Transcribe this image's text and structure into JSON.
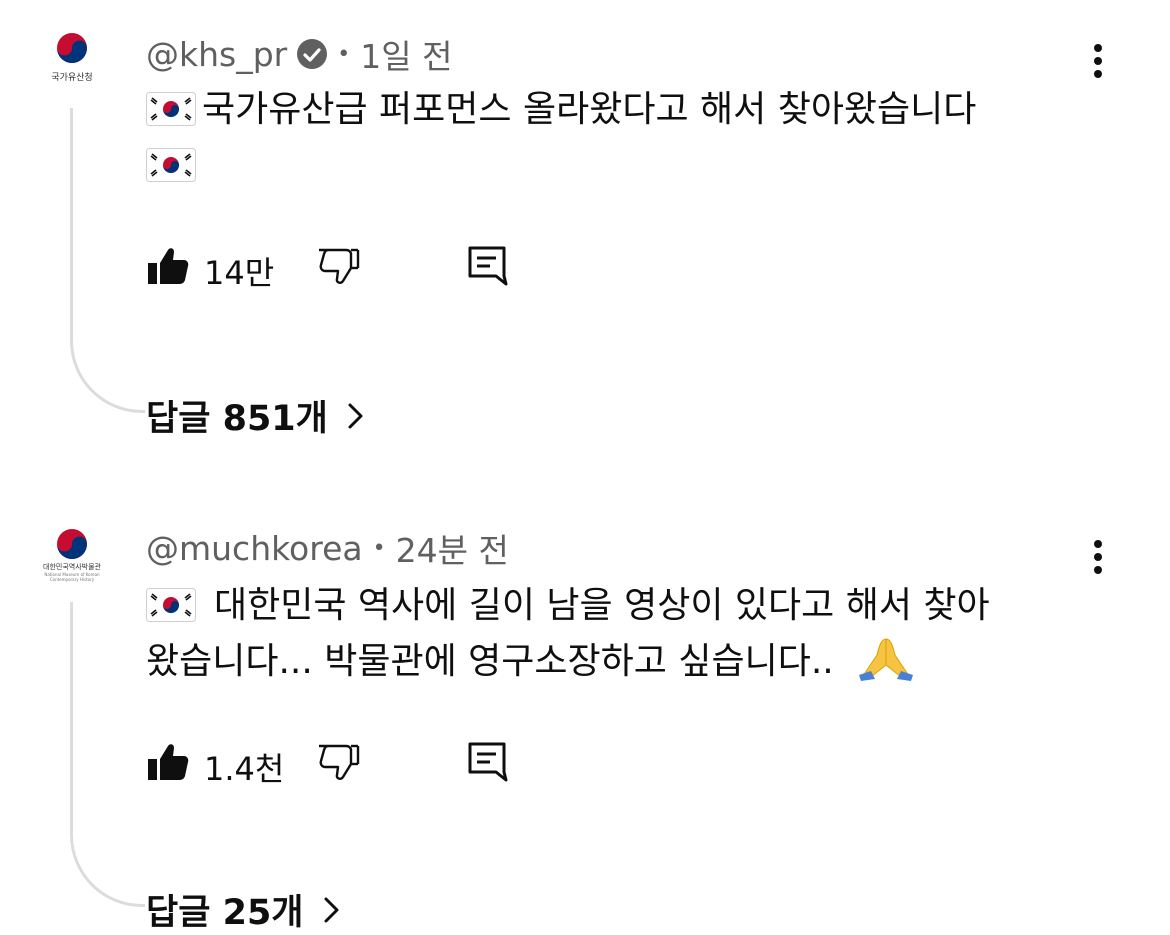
{
  "comments": [
    {
      "avatar_label": "국가유산청",
      "avatar_sub": "",
      "handle": "@khs_pr",
      "verified": true,
      "time": "1일 전",
      "text_line1": "국가유산급 퍼포먼스 올라왔다고 해서 찾아왔습니다",
      "text_line2": "",
      "likes": "14만",
      "replies": "답글 851개"
    },
    {
      "avatar_label": "대한민국역사박물관",
      "avatar_sub": "National Museum of Korean Contemporary History",
      "handle": "@muchkorea",
      "verified": false,
      "time": "24분 전",
      "text_line1": "대한민국 역사에 길이 남을 영상이 있다고 해서 찾아",
      "text_line2": "왔습니다... 박물관에 영구소장하고 싶습니다..",
      "likes": "1.4천",
      "replies": "답글 25개"
    }
  ],
  "icons": {
    "like": "thumbs-up-filled-icon",
    "dislike": "thumbs-down-outline-icon",
    "reply": "comment-icon",
    "more": "kebab-menu-icon",
    "flag": "south-korea-flag-emoji",
    "pray": "folded-hands-emoji"
  },
  "colors": {
    "text": "#0f0f0f",
    "meta": "#606060",
    "thread": "#dcdcdc"
  }
}
